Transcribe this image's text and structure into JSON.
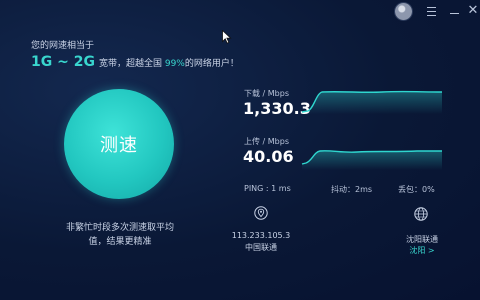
{
  "window": {
    "menu_icon": "menu-icon",
    "minimize_icon": "minimize-icon",
    "close_icon": "close-icon",
    "close_glyph": "✕"
  },
  "left": {
    "caption": "您的网速相当于",
    "speed_range": "1G ~ 2G",
    "broadband_prefix": "宽带，超越全国",
    "percent": "99%",
    "broadband_suffix": "的网络用户！",
    "test_button": "测速",
    "hint_line1": "非繁忙时段多次测速取平均",
    "hint_line2": "值，结果更精准"
  },
  "download": {
    "label": "下载 / Mbps",
    "value": "1,330.3"
  },
  "upload": {
    "label": "上传 / Mbps",
    "value": "40.06"
  },
  "stats": {
    "ping": "PING : 1 ms",
    "jitter": "抖动：2ms",
    "loss": "丢包：0%"
  },
  "client": {
    "icon": "location-pin-icon",
    "ip": "113.233.105.3",
    "isp": "中国联通"
  },
  "server": {
    "icon": "globe-icon",
    "name": "沈阳联通",
    "city": "沈阳 >"
  },
  "colors": {
    "accent": "#39d6ce",
    "background": "#0a1836",
    "graph_line": "#2fd6cf"
  }
}
